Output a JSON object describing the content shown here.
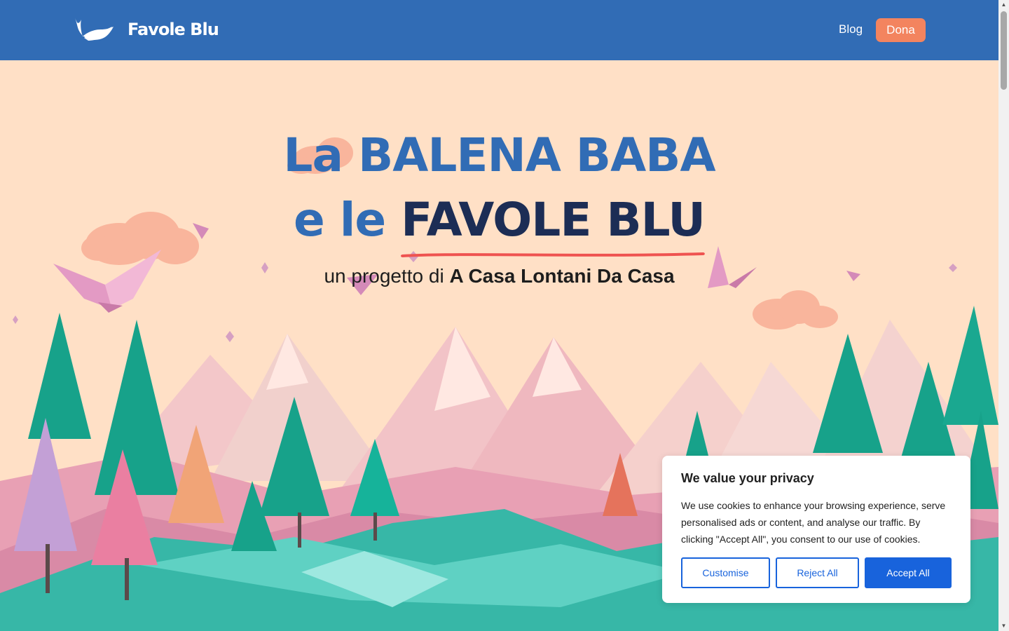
{
  "header": {
    "logo_text": "Favole Blu",
    "nav": {
      "blog": "Blog",
      "dona": "Dona"
    }
  },
  "hero": {
    "title_line1": "La BALENA BABA",
    "title_line2_prefix": "e le ",
    "title_line2_accent": "FAVOLE BLU",
    "subtitle_prefix": "un progetto di ",
    "subtitle_bold": "A Casa Lontani Da Casa"
  },
  "cookie": {
    "title": "We value your privacy",
    "text": "We use cookies to enhance your browsing experience, serve personalised ads or content, and analyse our traffic. By clicking \"Accept All\", you consent to our use of cookies.",
    "customise": "Customise",
    "reject": "Reject All",
    "accept": "Accept All"
  },
  "colors": {
    "header_bg": "#316cb5",
    "hero_bg": "#ffe0c6",
    "accent_button": "#f3845f",
    "title_blue": "#316cb5",
    "title_dark": "#1c2d55",
    "underline": "#ef5350",
    "cookie_primary": "#1863dc"
  }
}
